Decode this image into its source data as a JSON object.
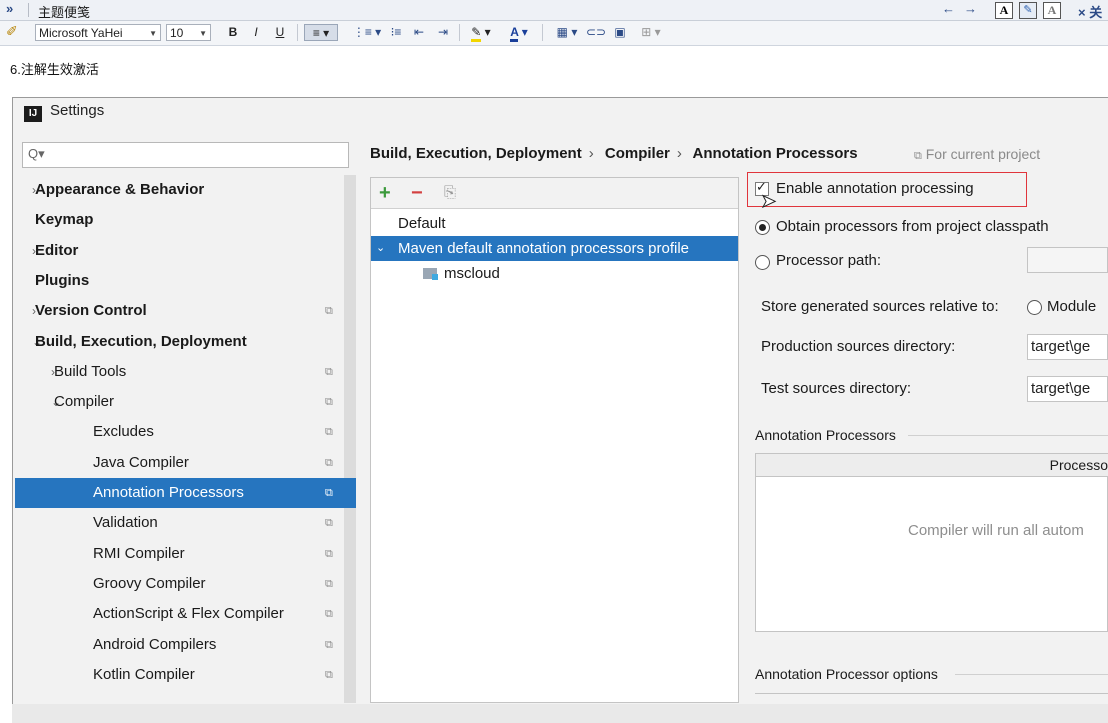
{
  "topbar": {
    "collapse_glyph": "»",
    "title": "主题便笺",
    "back_glyph": "←",
    "fwd_glyph": "→",
    "close_label": "× 关"
  },
  "editor_toolbar": {
    "font": "Microsoft YaHei",
    "size": "10",
    "bold": "B",
    "italic": "I",
    "underline": "U"
  },
  "note": {
    "heading": "6.注解生效激活"
  },
  "settings": {
    "window_title": "Settings",
    "search_placeholder": "Q▾",
    "tree": [
      {
        "label": "Appearance & Behavior",
        "bold": true,
        "indent": 0,
        "chevron": "›",
        "proj": false
      },
      {
        "label": "Keymap",
        "bold": true,
        "indent": 0,
        "chevron": "",
        "proj": false
      },
      {
        "label": "Editor",
        "bold": true,
        "indent": 0,
        "chevron": "›",
        "proj": false
      },
      {
        "label": "Plugins",
        "bold": true,
        "indent": 0,
        "chevron": "",
        "proj": false
      },
      {
        "label": "Version Control",
        "bold": true,
        "indent": 0,
        "chevron": "›",
        "proj": true
      },
      {
        "label": "Build, Execution, Deployment",
        "bold": true,
        "indent": 0,
        "chevron": "⌄",
        "proj": false
      },
      {
        "label": "Build Tools",
        "bold": false,
        "indent": 1,
        "chevron": "›",
        "proj": true
      },
      {
        "label": "Compiler",
        "bold": false,
        "indent": 1,
        "chevron": "⌄",
        "proj": true
      },
      {
        "label": "Excludes",
        "bold": false,
        "indent": 2,
        "chevron": "",
        "proj": true
      },
      {
        "label": "Java Compiler",
        "bold": false,
        "indent": 2,
        "chevron": "",
        "proj": true
      },
      {
        "label": "Annotation Processors",
        "bold": false,
        "indent": 2,
        "chevron": "",
        "proj": true,
        "selected": true
      },
      {
        "label": "Validation",
        "bold": false,
        "indent": 2,
        "chevron": "",
        "proj": true
      },
      {
        "label": "RMI Compiler",
        "bold": false,
        "indent": 2,
        "chevron": "",
        "proj": true
      },
      {
        "label": "Groovy Compiler",
        "bold": false,
        "indent": 2,
        "chevron": "",
        "proj": true
      },
      {
        "label": "ActionScript & Flex Compiler",
        "bold": false,
        "indent": 2,
        "chevron": "",
        "proj": true
      },
      {
        "label": "Android Compilers",
        "bold": false,
        "indent": 2,
        "chevron": "",
        "proj": true
      },
      {
        "label": "Kotlin Compiler",
        "bold": false,
        "indent": 2,
        "chevron": "",
        "proj": true
      }
    ],
    "breadcrumb": [
      "Build, Execution, Deployment",
      "Compiler",
      "Annotation Processors"
    ],
    "breadcrumb_sep": "›",
    "for_current_project": "For current project",
    "profiles": {
      "add": "+",
      "remove": "−",
      "items": [
        {
          "label": "Default",
          "selected": false
        },
        {
          "label": "Maven default annotation processors profile",
          "selected": true
        },
        {
          "label": "mscloud",
          "selected": false
        }
      ]
    },
    "options": {
      "enable_label": "Enable annotation processing",
      "enable_checked": true,
      "obtain_label": "Obtain processors from project classpath",
      "processor_path_label": "Processor path:",
      "store_label": "Store generated sources relative to:",
      "module_label": "Module",
      "prod_label": "Production sources directory:",
      "prod_value": "target\\ge",
      "test_label": "Test sources directory:",
      "test_value": "target\\ge",
      "ap_group": "Annotation Processors",
      "ap_column": "Processo",
      "ap_empty": "Compiler will run all autom",
      "opt_group": "Annotation Processor options"
    }
  }
}
